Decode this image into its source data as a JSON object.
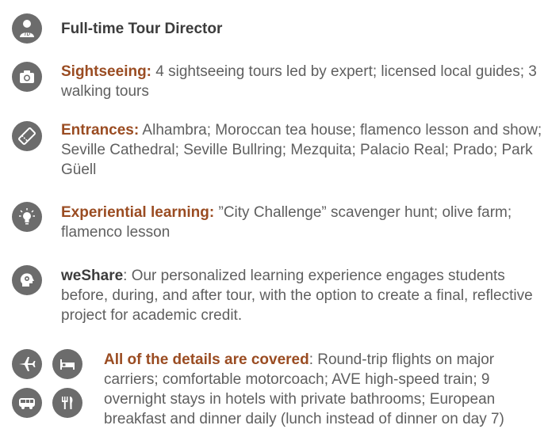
{
  "items": [
    {
      "title": "Full-time Tour Director",
      "desc": ""
    },
    {
      "title": "Sightseeing:",
      "desc": " 4 sightseeing tours led by expert; licensed local guides; 3 walking tours"
    },
    {
      "title": "Entrances:",
      "desc": " Alhambra; Moroccan tea house; flamenco lesson and show; Seville Cathedral; Seville Bullring; Mezquita; Palacio Real; Prado; Park Güell"
    },
    {
      "title": "Experiential learning:",
      "desc": " ”City Challenge” scavenger hunt; olive farm; flamenco lesson"
    },
    {
      "title": "weShare",
      "desc": ": Our personalized learning experience engages students before, during, and after tour, with the option to create a final, reflective project for academic credit."
    },
    {
      "title": "All of the details are covered",
      "desc": ": Round-trip flights on major carriers; comfortable motorcoach; AVE high-speed train; 9 overnight stays in hotels with private bathrooms; European breakfast and dinner daily (lunch instead of dinner on day 7)"
    }
  ],
  "icons": {
    "tour_director_badge": "TD"
  },
  "colors": {
    "icon_bg": "#6c6c6c",
    "title_dark": "#3c3c3c",
    "title_rust": "#9a4c22",
    "body_text": "#5f5f5f"
  }
}
